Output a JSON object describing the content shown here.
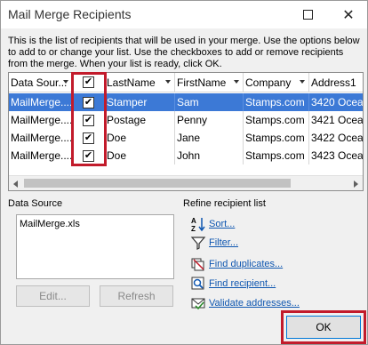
{
  "window": {
    "title": "Mail Merge Recipients"
  },
  "instructions": "This is the list of recipients that will be used in your merge.  Use the options below to add to or change your list.  Use the checkboxes to add or remove recipients from the merge.  When your list is ready, click OK.",
  "table": {
    "columns": [
      "Data Sour...",
      "",
      "LastName",
      "FirstName",
      "Company",
      "Address1"
    ],
    "rows": [
      {
        "source": "MailMerge....",
        "checked": "✔",
        "last": "Stamper",
        "first": "Sam",
        "company": "Stamps.com",
        "address": "3420 Ocea"
      },
      {
        "source": "MailMerge....",
        "checked": "✔",
        "last": "Postage",
        "first": "Penny",
        "company": "Stamps.com",
        "address": "3421 Ocea"
      },
      {
        "source": "MailMerge....",
        "checked": "✔",
        "last": "Doe",
        "first": "Jane",
        "company": "Stamps.com",
        "address": "3422 Ocea"
      },
      {
        "source": "MailMerge....",
        "checked": "✔",
        "last": "Doe",
        "first": "John",
        "company": "Stamps.com",
        "address": "3423 Ocea"
      }
    ],
    "header_check": "✔"
  },
  "data_source": {
    "label": "Data Source",
    "items": [
      "MailMerge.xls"
    ],
    "edit_label": "Edit...",
    "refresh_label": "Refresh"
  },
  "refine": {
    "label": "Refine recipient list",
    "items": [
      {
        "label": "Sort...",
        "icon": "sort-az-icon"
      },
      {
        "label": "Filter...",
        "icon": "filter-icon"
      },
      {
        "label": "Find duplicates...",
        "icon": "find-duplicates-icon"
      },
      {
        "label": "Find recipient...",
        "icon": "find-recipient-icon"
      },
      {
        "label": "Validate addresses...",
        "icon": "validate-addresses-icon"
      }
    ]
  },
  "ok_label": "OK",
  "colors": {
    "selection": "#3c79d6",
    "highlight": "#c21b2b",
    "link": "#0e56b0"
  }
}
